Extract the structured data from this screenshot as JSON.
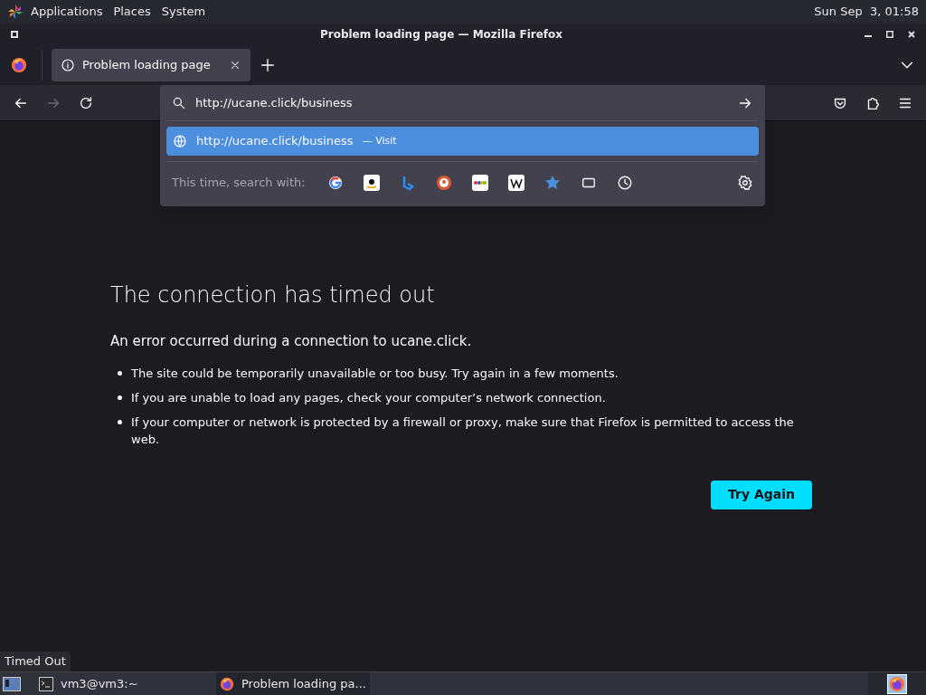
{
  "top_panel": {
    "menus": [
      "Applications",
      "Places",
      "System"
    ],
    "clock": "Sun Sep  3, 01:58"
  },
  "window": {
    "title": "Problem loading page — Mozilla Firefox"
  },
  "tabs": [
    {
      "label": "Problem loading page",
      "selected": true
    }
  ],
  "url_bar": {
    "value": "http://ucane.click/business"
  },
  "suggestions": [
    {
      "url": "http://ucane.click/business",
      "action": "— Visit",
      "selected": true
    }
  ],
  "search_with": {
    "label": "This time, search with:"
  },
  "error": {
    "title": "The connection has timed out",
    "subtitle": "An error occurred during a connection to ucane.click.",
    "bullets": [
      "The site could be temporarily unavailable or too busy. Try again in a few moments.",
      "If you are unable to load any pages, check your computer’s network connection.",
      "If your computer or network is protected by a firewall or proxy, make sure that Firefox is permitted to access the web."
    ],
    "button": "Try Again"
  },
  "status": "Timed Out",
  "taskbar": [
    {
      "label": "vm3@vm3:~",
      "kind": "terminal",
      "selected": false
    },
    {
      "label": "Problem loading pa...",
      "kind": "browser",
      "selected": true
    }
  ]
}
